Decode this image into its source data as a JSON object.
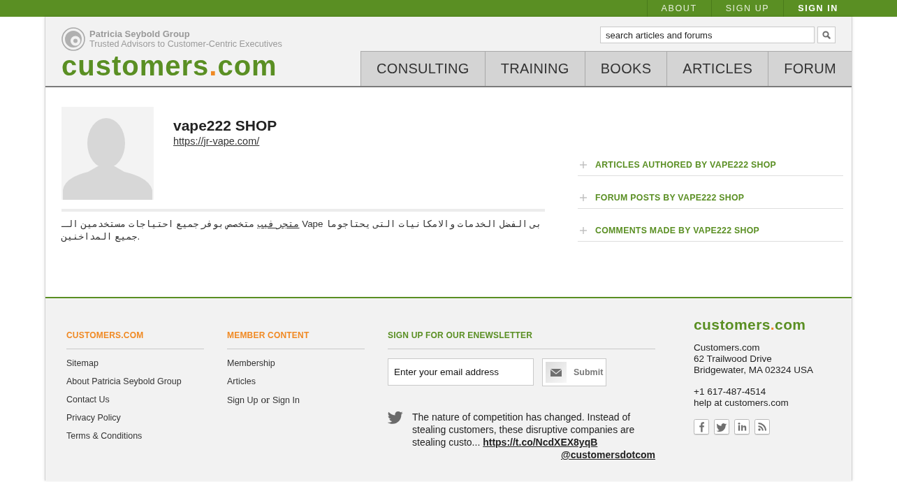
{
  "top_nav": [
    {
      "label": "ABOUT",
      "primary": false
    },
    {
      "label": "SIGN UP",
      "primary": false
    },
    {
      "label": "SIGN IN",
      "primary": true
    }
  ],
  "header": {
    "brand": {
      "company": "Patricia Seybold Group",
      "tagline": "Trusted Advisors to Customer-Centric Executives"
    },
    "logo": {
      "name": "customers",
      "dot": ".",
      "suffix": "com"
    },
    "search": {
      "placeholder": "search articles and forums"
    },
    "main_nav": [
      "CONSULTING",
      "TRAINING",
      "BOOKS",
      "ARTICLES",
      "FORUM"
    ]
  },
  "profile": {
    "name": "vape222 SHOP",
    "website": "https://jr-vape.com/",
    "bio": {
      "link": "متجر فيب",
      "text": "متخصص بوفر جميع احتياجات مستخدمين الـ Vape بى الفضل الخدمات والامكانيات التى يحتاجوما جميع المداخنين."
    }
  },
  "activity_links": [
    "ARTICLES AUTHORED BY VAPE222 SHOP",
    "FORUM POSTS BY VAPE222 SHOP",
    "COMMENTS MADE BY VAPE222 SHOP"
  ],
  "footer": {
    "columns": [
      {
        "heading": "CUSTOMERS.COM",
        "links": [
          "Sitemap",
          "About Patricia Seybold Group",
          "Contact Us",
          "Privacy Policy",
          "Terms & Conditions"
        ]
      },
      {
        "heading": "MEMBER CONTENT",
        "links": [
          "Membership",
          "Articles"
        ],
        "account": {
          "sign_up": "Sign Up",
          "joiner": "or",
          "sign_in": "Sign In"
        }
      }
    ],
    "newsletter": {
      "heading": "SIGN UP FOR OUR ENEWSLETTER",
      "email_field": {
        "placeholder": "Enter your email address"
      },
      "submit": "Submit"
    },
    "tweet": {
      "text": "The nature of competition has changed. Instead of stealing customers, these disruptive companies are stealing custo...",
      "link": "https://t.co/NcdXEX8yqB",
      "handle": "@customersdotcom"
    },
    "contact": {
      "logo": {
        "name": "customers",
        "dot": ".",
        "suffix": "com"
      },
      "address_lines": [
        "Customers.com",
        "62 Trailwood Drive",
        "Bridgewater, MA 02324 USA"
      ],
      "phone": "+1 617-487-4514",
      "email": "help at customers.com"
    }
  }
}
